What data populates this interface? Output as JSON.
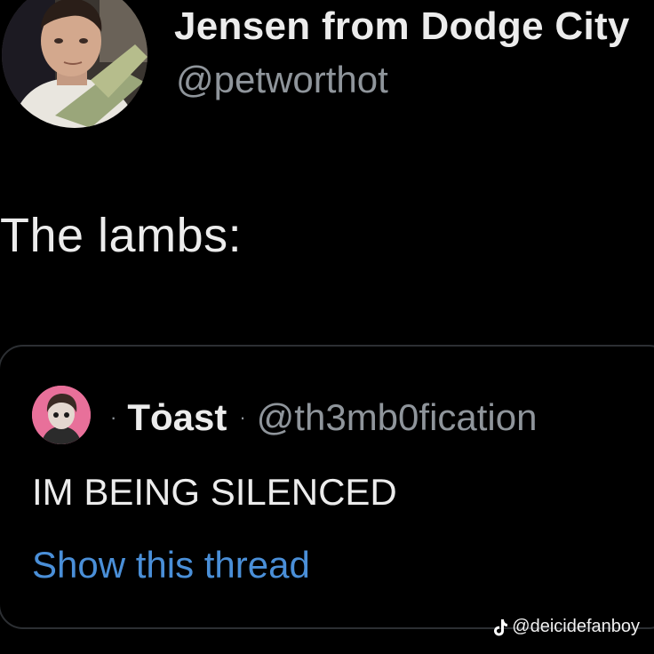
{
  "author": {
    "display_name": "Jensen from Dodge City",
    "handle": "@petworthot",
    "avatar_icon": "profile-photo"
  },
  "tweet": {
    "text": "The lambs:"
  },
  "quoted_tweet": {
    "separator": "·",
    "display_name": "Tȯast",
    "handle": "@th3mb0fication",
    "avatar_icon": "profile-photo",
    "text": "IM BEING SILENCED",
    "show_thread_label": "Show this thread"
  },
  "watermark": {
    "icon": "tiktok-icon",
    "text": "@deicidefanboy"
  },
  "colors": {
    "background": "#000000",
    "link": "#4a8fd8",
    "secondary_text": "#8f959b"
  }
}
